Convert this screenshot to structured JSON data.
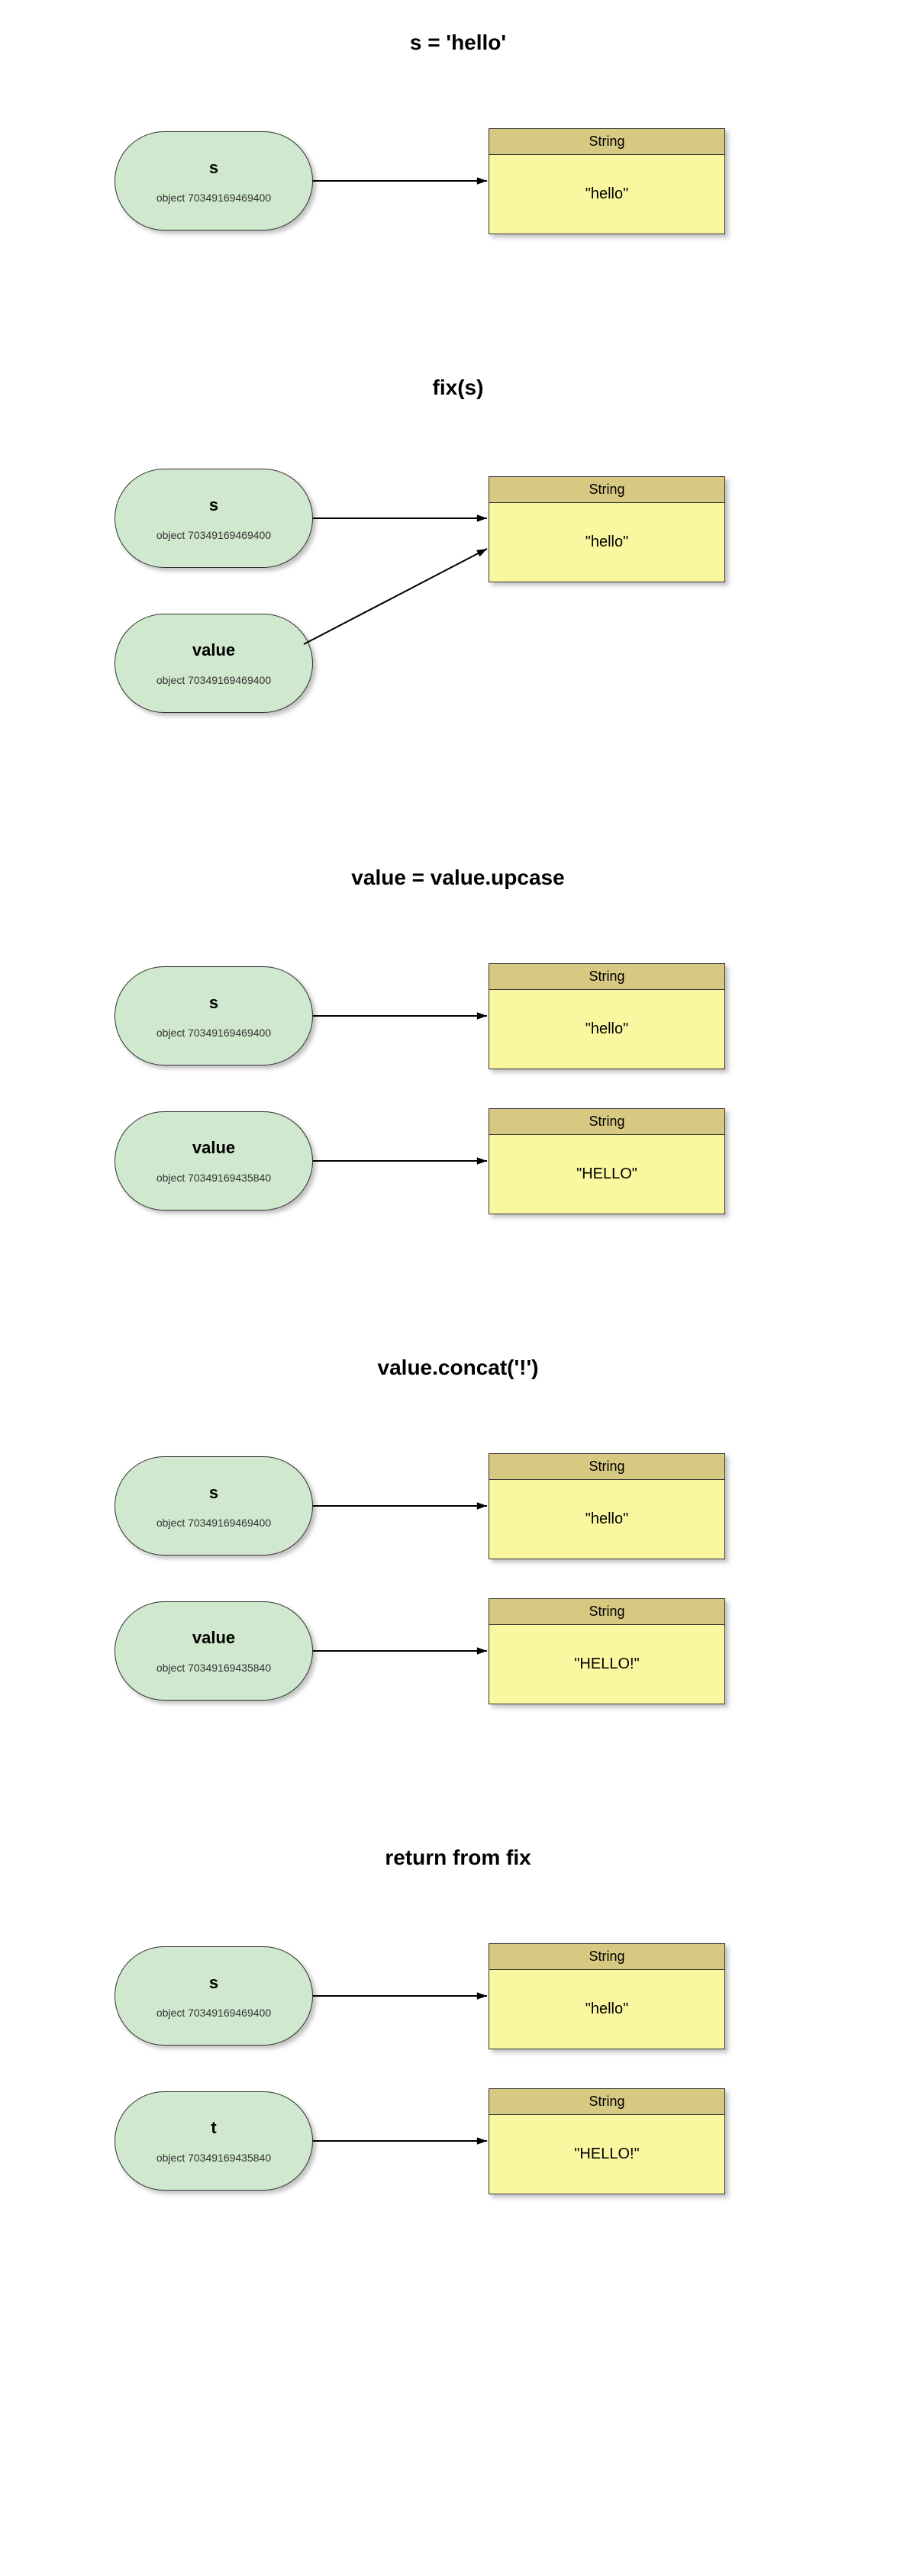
{
  "object_id_a": "70349169469400",
  "object_id_b": "70349169435840",
  "type_label": "String",
  "object_prefix": "object",
  "sections": [
    {
      "title": "s = 'hello'",
      "layout": "single",
      "vars": [
        {
          "name": "s",
          "id_key": "object_id_a"
        }
      ],
      "objs": [
        {
          "value": "\"hello\""
        }
      ]
    },
    {
      "title": "fix(s)",
      "layout": "converge",
      "vars": [
        {
          "name": "s",
          "id_key": "object_id_a"
        },
        {
          "name": "value",
          "id_key": "object_id_a"
        }
      ],
      "objs": [
        {
          "value": "\"hello\""
        }
      ]
    },
    {
      "title": "value = value.upcase",
      "layout": "parallel",
      "vars": [
        {
          "name": "s",
          "id_key": "object_id_a"
        },
        {
          "name": "value",
          "id_key": "object_id_b"
        }
      ],
      "objs": [
        {
          "value": "\"hello\""
        },
        {
          "value": "\"HELLO\""
        }
      ]
    },
    {
      "title": "value.concat('!')",
      "layout": "parallel",
      "vars": [
        {
          "name": "s",
          "id_key": "object_id_a"
        },
        {
          "name": "value",
          "id_key": "object_id_b"
        }
      ],
      "objs": [
        {
          "value": "\"hello\""
        },
        {
          "value": "\"HELLO!\""
        }
      ]
    },
    {
      "title": "return from fix",
      "layout": "parallel",
      "vars": [
        {
          "name": "s",
          "id_key": "object_id_a"
        },
        {
          "name": "t",
          "id_key": "object_id_b"
        }
      ],
      "objs": [
        {
          "value": "\"hello\""
        },
        {
          "value": "\"HELLO!\""
        }
      ]
    }
  ]
}
